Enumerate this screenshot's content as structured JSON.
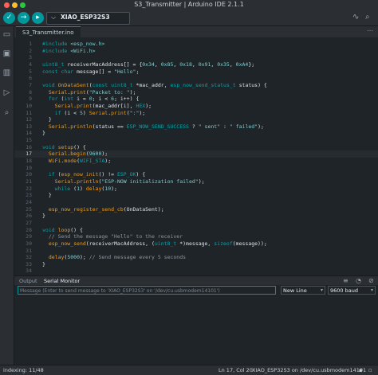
{
  "window": {
    "title": "S3_Transmitter | Arduino IDE 2.1.1"
  },
  "toolbar": {
    "verify_icon": "check-icon",
    "upload_icon": "arrow-right-icon",
    "debug_icon": "debug-icon",
    "board_name": "XIAO_ESP32S3"
  },
  "editor": {
    "tab": "S3_Transmitter.ino",
    "lines": [
      {
        "n": "1",
        "html": "<span class='k'>#include</span> <span class='s'>&lt;esp_now.h&gt;</span>"
      },
      {
        "n": "2",
        "html": "<span class='k'>#include</span> <span class='s'>&lt;WiFi.h&gt;</span>"
      },
      {
        "n": "3",
        "html": ""
      },
      {
        "n": "4",
        "html": "<span class='ty'>uint8_t</span> receiverMacAddress[] = {<span class='n'>0x34</span>, <span class='n'>0x85</span>, <span class='n'>0x18</span>, <span class='n'>0x91</span>, <span class='n'>0x35</span>, <span class='n'>0xA4</span>};"
      },
      {
        "n": "5",
        "html": "<span class='k'>const</span> <span class='k'>char</span> message[] = <span class='s'>\"Hello\"</span>;"
      },
      {
        "n": "6",
        "html": ""
      },
      {
        "n": "7",
        "html": "<span class='k'>void</span> <span class='f'>OnDataSent</span>(<span class='k'>const</span> <span class='ty'>uint8_t</span> *mac_addr, <span class='ty'>esp_now_send_status_t</span> status) {"
      },
      {
        "n": "8",
        "html": "  <span class='f'>Serial</span>.<span class='f'>print</span>(<span class='s'>\"Packet to: \"</span>);"
      },
      {
        "n": "9",
        "html": "  <span class='k'>for</span> (<span class='k'>int</span> i = <span class='n'>0</span>; i &lt; <span class='n'>6</span>; i++) {"
      },
      {
        "n": "10",
        "html": "    <span class='f'>Serial</span>.<span class='f'>print</span>(mac_addr[i], <span class='ty'>HEX</span>);"
      },
      {
        "n": "11",
        "html": "    <span class='k'>if</span> (i &lt; <span class='n'>5</span>) <span class='f'>Serial</span>.<span class='f'>print</span>(<span class='s'>\":\"</span>);"
      },
      {
        "n": "12",
        "html": "  }"
      },
      {
        "n": "13",
        "html": "  <span class='f'>Serial</span>.<span class='f'>println</span>(status == <span class='ty'>ESP_NOW_SEND_SUCCESS</span> ? <span class='s'>\" sent\"</span> : <span class='s'>\" failed\"</span>);"
      },
      {
        "n": "14",
        "html": "}"
      },
      {
        "n": "15",
        "html": ""
      },
      {
        "n": "16",
        "html": "<span class='k'>void</span> <span class='f'>setup</span>() {"
      },
      {
        "n": "17",
        "html": "  <span class='f'>Serial</span>.<span class='f'>begin</span>(<span class='n'>9600</span>);"
      },
      {
        "n": "18",
        "html": "  <span class='f'>WiFi</span>.<span class='f'>mode</span>(<span class='ty'>WIFI_STA</span>);"
      },
      {
        "n": "19",
        "html": ""
      },
      {
        "n": "20",
        "html": "  <span class='k'>if</span> (<span class='f'>esp_now_init</span>() != <span class='ty'>ESP_OK</span>) {"
      },
      {
        "n": "21",
        "html": "    <span class='f'>Serial</span>.<span class='f'>println</span>(<span class='s'>\"ESP-NOW initialization failed\"</span>);"
      },
      {
        "n": "22",
        "html": "    <span class='k'>while</span> (<span class='n'>1</span>) <span class='f'>delay</span>(<span class='n'>10</span>);"
      },
      {
        "n": "23",
        "html": "  }"
      },
      {
        "n": "24",
        "html": ""
      },
      {
        "n": "25",
        "html": "  <span class='f'>esp_now_register_send_cb</span>(OnDataSent);"
      },
      {
        "n": "26",
        "html": "}"
      },
      {
        "n": "27",
        "html": ""
      },
      {
        "n": "28",
        "html": "<span class='k'>void</span> <span class='f'>loop</span>() {"
      },
      {
        "n": "29",
        "html": "  <span class='c'>// Send the message \"Hello\" to the receiver</span>"
      },
      {
        "n": "30",
        "html": "  <span class='f'>esp_now_send</span>(receiverMacAddress, (<span class='ty'>uint8_t</span> *)message, <span class='k'>sizeof</span>(message));"
      },
      {
        "n": "31",
        "html": ""
      },
      {
        "n": "32",
        "html": "  <span class='f'>delay</span>(<span class='n'>5000</span>); <span class='c'>// Send message every 5 seconds</span>"
      },
      {
        "n": "33",
        "html": "}"
      },
      {
        "n": "34",
        "html": ""
      }
    ]
  },
  "panel": {
    "tab_output": "Output",
    "tab_serial": "Serial Monitor"
  },
  "serial": {
    "input_placeholder": "Message (Enter to send message to 'XIAO_ESP32S3' on '/dev/cu.usbmodem14101')",
    "line_ending": "New Line",
    "baud": "9600 baud"
  },
  "status": {
    "indexing": "indexing: 11/48",
    "position": "Ln 17, Col 20",
    "board": "XIAO_ESP32S3 on /dev/cu.usbmodem14101"
  }
}
